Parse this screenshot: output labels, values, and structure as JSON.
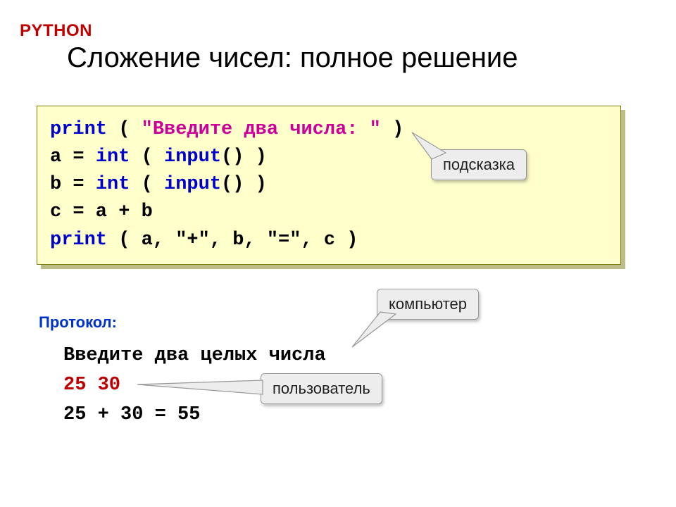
{
  "language_label": "PYTHON",
  "title": "Сложение чисел: полное решение",
  "code": {
    "print_kw": "print",
    "lp": " ( ",
    "rp": " )",
    "string_literal": "\"Введите два числа: \"",
    "line2_a": "a",
    "line2_eq": " = ",
    "int_kw": "int",
    "input_kw": "input",
    "lparen": " ( ",
    "rparen_empty": "() )",
    "line3_b": "b",
    "line4": "c = a + b",
    "print2_args": " ( a, \"+\", b, \"=\", c )"
  },
  "callouts": {
    "hint": "подсказка",
    "computer": "компьютер",
    "user": "пользователь"
  },
  "protocol_label": "Протокол:",
  "protocol": {
    "line1": "Введите два целых числа",
    "line2": "25 30",
    "line3": "25 + 30 = 55"
  }
}
